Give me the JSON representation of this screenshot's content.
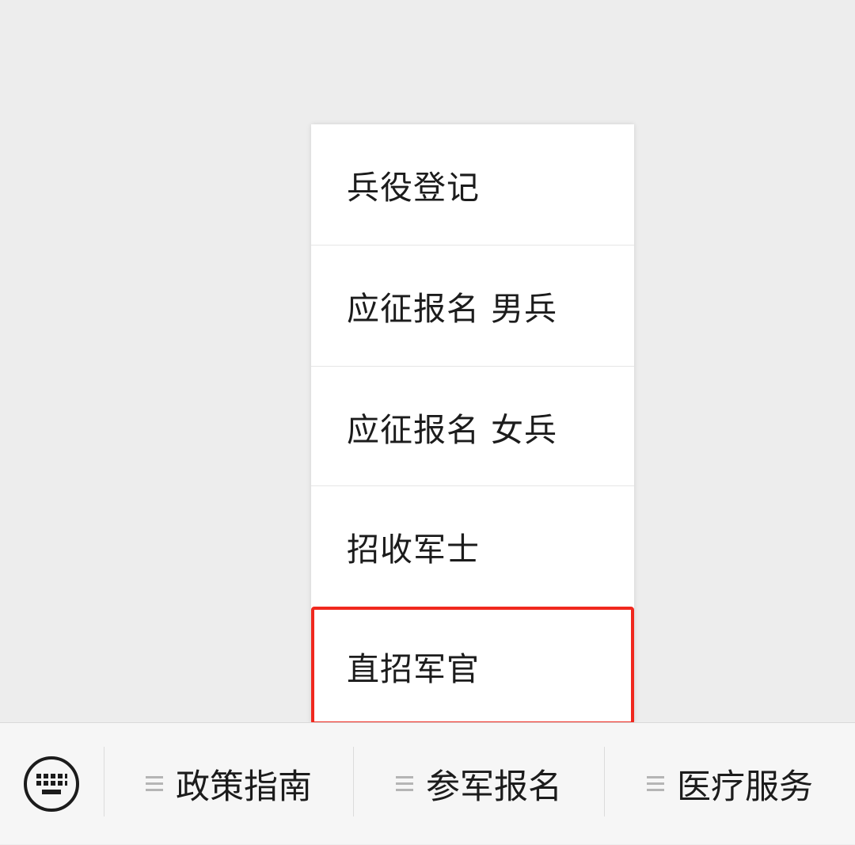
{
  "popup_menu": {
    "items": [
      {
        "label": "兵役登记"
      },
      {
        "label": "应征报名 男兵"
      },
      {
        "label": "应征报名 女兵"
      },
      {
        "label": "招收军士"
      },
      {
        "label": "直招军官"
      }
    ],
    "highlight_color": "#f0281e"
  },
  "bottom_bar": {
    "keyboard_icon": "keyboard-icon",
    "menus": [
      {
        "label": "政策指南",
        "icon": "hamburger-icon"
      },
      {
        "label": "参军报名",
        "icon": "hamburger-icon"
      },
      {
        "label": "医疗服务",
        "icon": "hamburger-icon"
      }
    ]
  }
}
